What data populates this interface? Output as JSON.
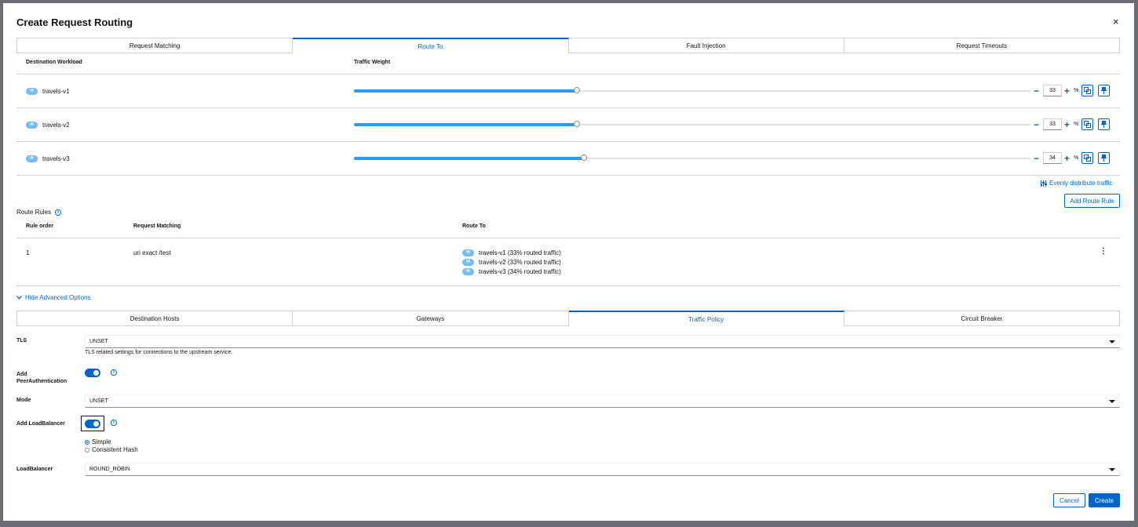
{
  "modal": {
    "title": "Create Request Routing",
    "close": "×"
  },
  "top_tabs": [
    {
      "label": "Request Matching",
      "active": false
    },
    {
      "label": "Route To",
      "active": true
    },
    {
      "label": "Fault Injection",
      "active": false
    },
    {
      "label": "Request Timeouts",
      "active": false
    }
  ],
  "workloads_table": {
    "headers": {
      "workload": "Destination Workload",
      "weight": "Traffic Weight"
    },
    "badge": "W",
    "unit": "%",
    "rows": [
      {
        "name": "travels-v1",
        "weight": "33",
        "weight_value": 33
      },
      {
        "name": "travels-v2",
        "weight": "33",
        "weight_value": 33
      },
      {
        "name": "travels-v3",
        "weight": "34",
        "weight_value": 34
      }
    ]
  },
  "actions": {
    "evenly": "Evenly distribute traffic",
    "add_route_rule": "Add Route Rule"
  },
  "route_rules": {
    "title": "Route Rules",
    "headers": {
      "order": "Rule order",
      "matching": "Request Matching",
      "route_to": "Route To"
    },
    "rows": [
      {
        "order": "1",
        "matching": "uri exact /test",
        "routes": [
          "travels-v1 (33% routed traffic)",
          "travels-v2 (33% routed traffic)",
          "travels-v3 (34% routed traffic)"
        ]
      }
    ]
  },
  "advanced": {
    "toggle_label": "Hide Advanced Options"
  },
  "advanced_tabs": [
    {
      "label": "Destination Hosts",
      "active": false
    },
    {
      "label": "Gateways",
      "active": false
    },
    {
      "label": "Traffic Policy",
      "active": true
    },
    {
      "label": "Circuit Breaker",
      "active": false
    }
  ],
  "traffic_policy": {
    "tls_label": "TLS",
    "tls_value": "UNSET",
    "tls_help": "TLS related settings for connections to the upstream service.",
    "peer_auth_label_1": "Add",
    "peer_auth_label_2": "PeerAuthentication",
    "peer_auth_enabled": true,
    "mode_label": "Mode",
    "mode_value": "UNSET",
    "lb_label": "Add LoadBalancer",
    "lb_enabled": true,
    "lb_options": [
      {
        "label": "Simple",
        "checked": true
      },
      {
        "label": "Consistent Hash",
        "checked": false
      }
    ],
    "loadbalancer_label": "LoadBalancer",
    "loadbalancer_value": "ROUND_ROBIN"
  },
  "footer": {
    "cancel": "Cancel",
    "create": "Create"
  },
  "colors": {
    "primary": "#0066cc",
    "badge": "#73bcf7",
    "slider": "#2b9af3"
  }
}
